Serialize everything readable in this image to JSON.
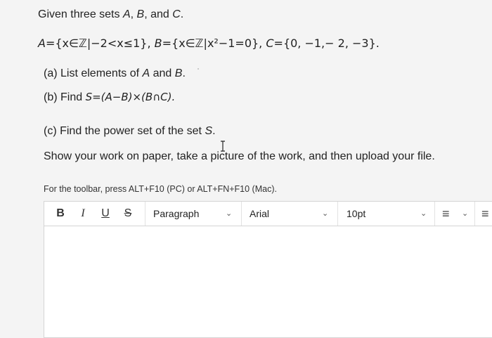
{
  "question": {
    "intro_text": "Given three sets ",
    "set_A": "A",
    "set_B": "B",
    "set_C": "C",
    "and_text": ", and ",
    "comma_text": ", ",
    "period": ".",
    "def_A": "={x∈ℤ|−2<x≤1},",
    "def_B": "={x∈ℤ|x²−1=0},",
    "def_C": "={0, −1,− 2, −3}.",
    "part_a_prefix": "(a) List elements of ",
    "part_a_suffix": ".",
    "part_b_prefix": "(b) Find  ",
    "part_b_expr": "S=(A−B)×(B∩C).",
    "part_c_prefix": "(c) Find the power set of the set ",
    "set_S": "S",
    "instructions": "Show your work on paper, take a picture of the work, and then upload your file."
  },
  "editor": {
    "hint": "For the toolbar, press ALT+F10 (PC) or ALT+FN+F10 (Mac).",
    "bold_label": "B",
    "italic_label": "I",
    "underline_label": "U",
    "strike_label": "S",
    "paragraph_label": "Paragraph",
    "font_label": "Arial",
    "size_label": "10pt",
    "chevron": "⌄",
    "list_icon": "≡"
  }
}
